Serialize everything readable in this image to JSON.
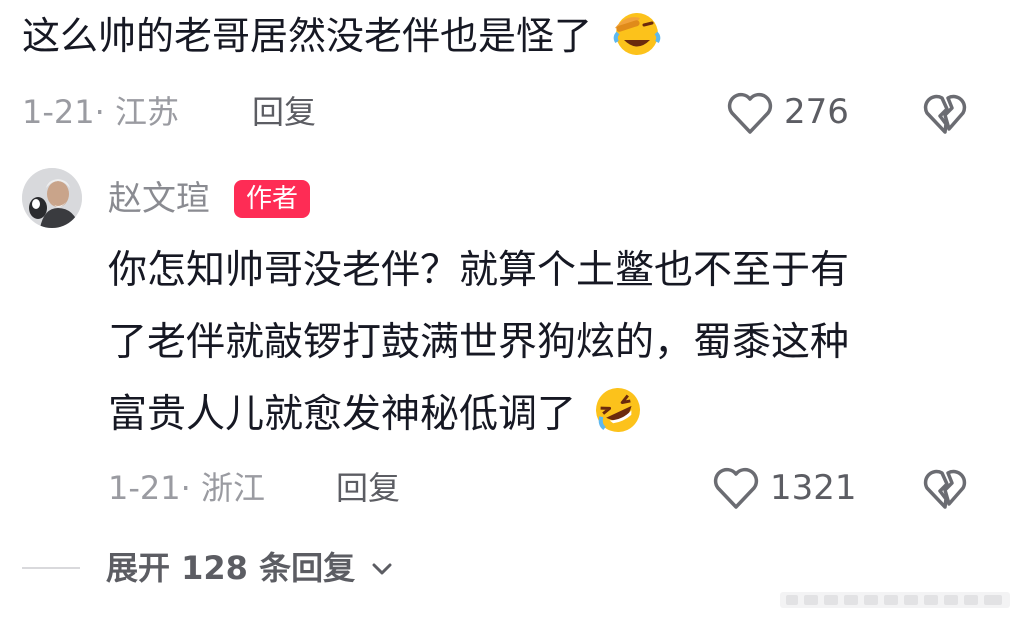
{
  "comment1": {
    "text": "这么帅的老哥居然没老伴也是怪了",
    "emoji": "face-with-hand-over-eyes-laughing-emoji",
    "date_location": "1-21· 江苏",
    "reply_label": "回复",
    "likes": "276"
  },
  "comment2": {
    "author": "赵文瑄",
    "author_badge": "作者",
    "lines": [
      "你怎知帅哥没老伴？就算个土鳖也不至于有",
      "了老伴就敲锣打鼓满世界狗炫的，蜀黍这种",
      "富贵人儿就愈发神秘低调了"
    ],
    "emoji": "rolling-on-floor-laughing-emoji",
    "date_location": "1-21· 浙江",
    "reply_label": "回复",
    "likes": "1321"
  },
  "expand_replies": "展开 128 条回复",
  "colors": {
    "badge": "#fe2c55",
    "text": "#161823",
    "muted": "#9a9ba1",
    "secondary": "#5c5d63"
  }
}
